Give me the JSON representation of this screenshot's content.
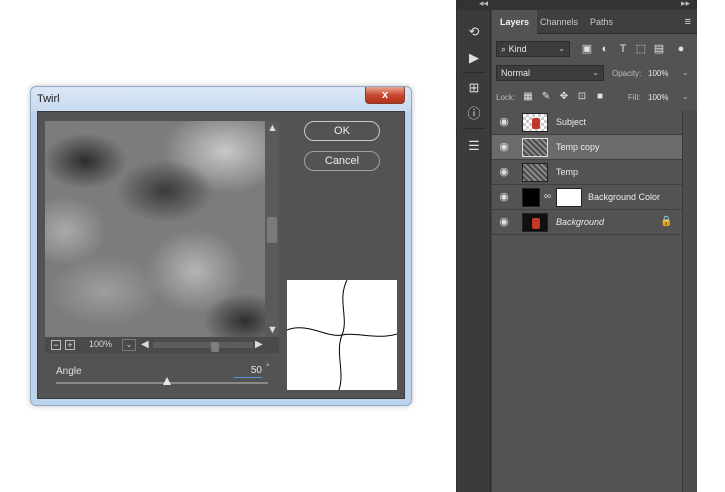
{
  "dialog": {
    "title": "Twirl",
    "close_glyph": "x",
    "ok_label": "OK",
    "cancel_label": "Cancel",
    "zoom": "100%",
    "angle_label": "Angle",
    "angle_value": "50",
    "angle_unit": "°",
    "angle_range": [
      -999,
      999
    ],
    "angle_fraction": 0.525
  },
  "panel": {
    "collapse_left": "◂◂",
    "collapse_right": "▸▸",
    "tabs": [
      {
        "label": "Layers",
        "active": true
      },
      {
        "label": "Channels",
        "active": false
      },
      {
        "label": "Paths",
        "active": false
      }
    ],
    "filter_kind": "Kind",
    "blend_mode": "Normal",
    "opacity_label": "Opacity:",
    "opacity_value": "100%",
    "lock_label": "Lock:",
    "fill_label": "Fill:",
    "fill_value": "100%",
    "layers": [
      {
        "name": "Subject",
        "selected": false,
        "italic": false
      },
      {
        "name": "Temp copy",
        "selected": true,
        "italic": false
      },
      {
        "name": "Temp",
        "selected": false,
        "italic": false
      },
      {
        "name": "Background Color",
        "selected": false,
        "italic": false
      },
      {
        "name": "Background",
        "selected": false,
        "italic": true
      }
    ]
  },
  "icons": {
    "menu": "≡",
    "search": "⌕",
    "eye": "◉",
    "lock": "🔒"
  }
}
